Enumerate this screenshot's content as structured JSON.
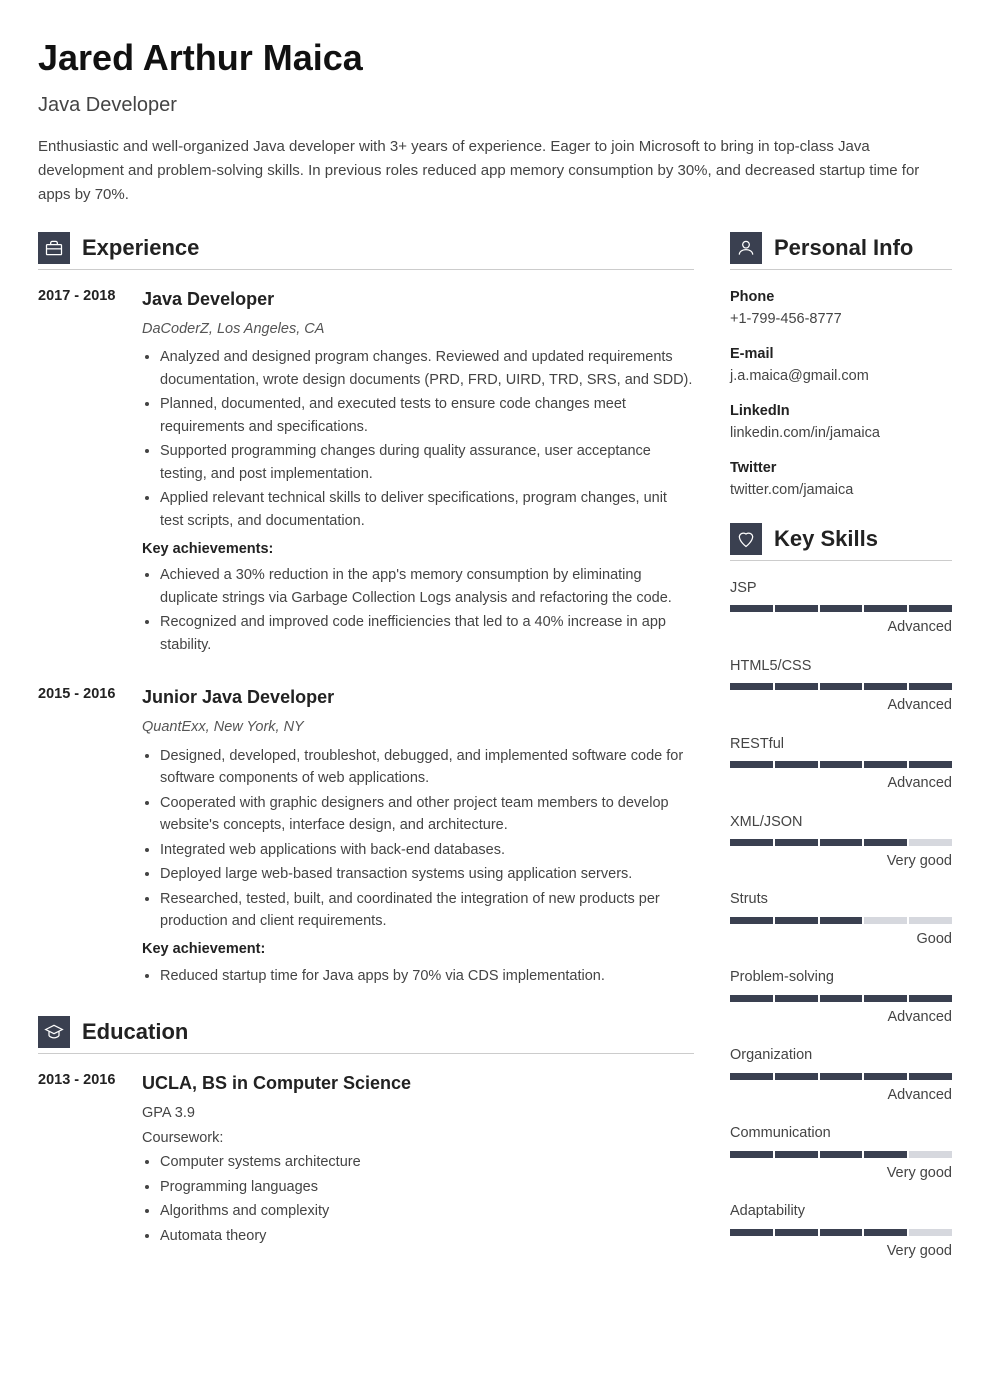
{
  "header": {
    "name": "Jared Arthur Maica",
    "title": "Java Developer",
    "summary": "Enthusiastic and well-organized Java developer with 3+ years of experience. Eager to join Microsoft to bring in top-class Java development and problem-solving skills. In previous roles reduced app memory consumption by 30%, and decreased startup time for apps by 70%."
  },
  "sections": {
    "experience": "Experience",
    "education": "Education",
    "personal": "Personal Info",
    "skills": "Key Skills"
  },
  "experience": [
    {
      "dates": "2017 - 2018",
      "title": "Java Developer",
      "company": "DaCoderZ, Los Angeles, CA",
      "bullets": [
        "Analyzed and designed program changes. Reviewed and updated requirements documentation, wrote design documents (PRD, FRD, UIRD, TRD, SRS, and SDD).",
        "Planned, documented, and executed tests to ensure code changes meet requirements and specifications.",
        "Supported programming changes during quality assurance, user acceptance testing, and post implementation.",
        "Applied relevant technical skills to deliver specifications, program changes, unit test scripts, and documentation."
      ],
      "ach_label": "Key achievements:",
      "achievements": [
        "Achieved a 30% reduction in the app's memory consumption by eliminating duplicate strings via Garbage Collection Logs analysis and refactoring the code.",
        "Recognized and improved code inefficiencies that led to a 40% increase in app stability."
      ]
    },
    {
      "dates": "2015 - 2016",
      "title": "Junior Java Developer",
      "company": "QuantExx, New York, NY",
      "bullets": [
        "Designed, developed, troubleshot, debugged, and implemented software code for software components of web applications.",
        "Cooperated with graphic designers and other project team members to develop website's concepts, interface design, and architecture.",
        "Integrated web applications with back-end databases.",
        "Deployed large web-based transaction systems using application servers.",
        "Researched, tested, built, and coordinated the integration of new products per production and client requirements."
      ],
      "ach_label": "Key achievement:",
      "achievements": [
        "Reduced startup time for Java apps by 70% via CDS implementation."
      ]
    }
  ],
  "education": [
    {
      "dates": "2013 - 2016",
      "title": "UCLA, BS in Computer Science",
      "gpa": "GPA 3.9",
      "cw_label": "Coursework:",
      "coursework": [
        "Computer systems architecture",
        "Programming languages",
        "Algorithms and complexity",
        "Automata theory"
      ]
    }
  ],
  "personal": [
    {
      "label": "Phone",
      "value": "+1-799-456-8777"
    },
    {
      "label": "E-mail",
      "value": "j.a.maica@gmail.com"
    },
    {
      "label": "LinkedIn",
      "value": "linkedin.com/in/jamaica"
    },
    {
      "label": "Twitter",
      "value": "twitter.com/jamaica"
    }
  ],
  "skills": [
    {
      "name": "JSP",
      "level": "Advanced",
      "fill": 5
    },
    {
      "name": "HTML5/CSS",
      "level": "Advanced",
      "fill": 5
    },
    {
      "name": "RESTful",
      "level": "Advanced",
      "fill": 5
    },
    {
      "name": "XML/JSON",
      "level": "Very good",
      "fill": 4
    },
    {
      "name": "Struts",
      "level": "Good",
      "fill": 3
    },
    {
      "name": "Problem-solving",
      "level": "Advanced",
      "fill": 5
    },
    {
      "name": "Organization",
      "level": "Advanced",
      "fill": 5
    },
    {
      "name": "Communication",
      "level": "Very good",
      "fill": 4
    },
    {
      "name": "Adaptability",
      "level": "Very good",
      "fill": 4
    }
  ]
}
